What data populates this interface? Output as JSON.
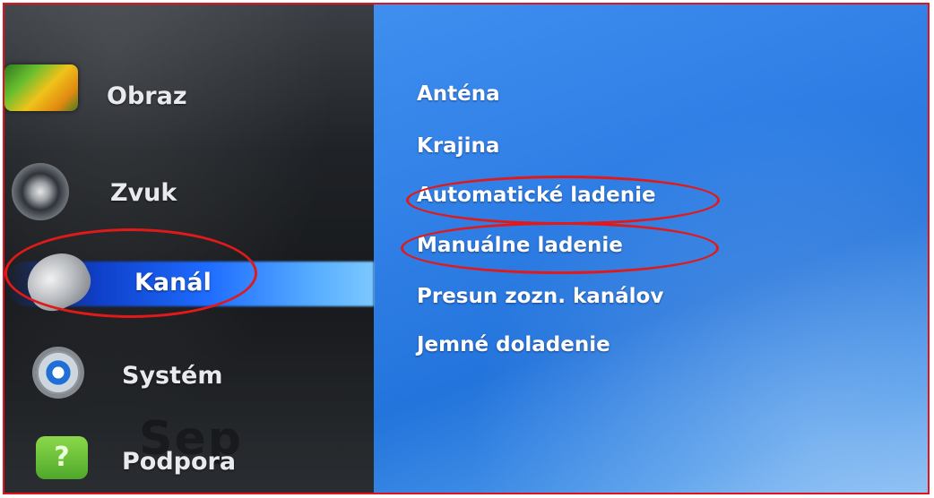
{
  "main_menu": {
    "items": [
      {
        "label": "Obraz",
        "icon": "picture-icon",
        "selected": false
      },
      {
        "label": "Zvuk",
        "icon": "speaker-icon",
        "selected": false
      },
      {
        "label": "Kanál",
        "icon": "satellite-dish-icon",
        "selected": true
      },
      {
        "label": "Systém",
        "icon": "gear-icon",
        "selected": false
      },
      {
        "label": "Podpora",
        "icon": "help-icon",
        "selected": false
      }
    ]
  },
  "submenu": {
    "items": [
      {
        "label": "Anténa"
      },
      {
        "label": "Krajina"
      },
      {
        "label": "Automatické ladenie",
        "annotated": true
      },
      {
        "label": "Manuálne ladenie",
        "annotated": true
      },
      {
        "label": "Presun zozn. kanálov"
      },
      {
        "label": "Jemné doladenie"
      }
    ]
  },
  "support_icon_glyph": "?",
  "background_text": "Sep",
  "colors": {
    "annotation": "#e01a1a",
    "highlight": "#1e6cff",
    "submenu_bg": "#2f7fe6",
    "menu_bg": "#1f2226",
    "frame_border": "#e0141e"
  }
}
